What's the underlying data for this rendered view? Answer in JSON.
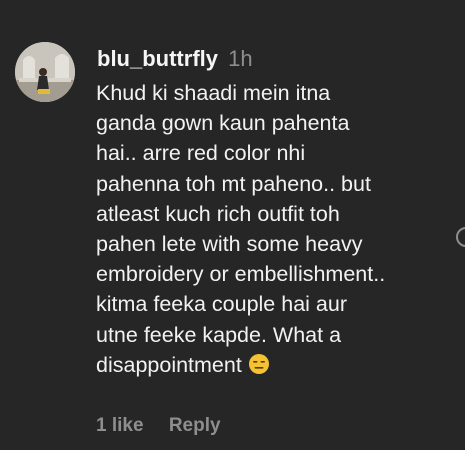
{
  "comment": {
    "username": "blu_buttrfly",
    "time": "1h",
    "lines": [
      "Khud ki shaadi mein itna",
      "ganda gown kaun pahenta",
      "hai.. arre red color nhi",
      "pahenna toh mt paheno.. but",
      "atleast kuch rich outfit toh",
      "pahen lete with some heavy",
      "embroidery or embellishment..",
      "kitma feeka couple hai aur",
      "utne feeke kapde. What a",
      "disappointment"
    ],
    "emoji": "expressionless-face-emoji",
    "likes": "1 like",
    "reply_label": "Reply"
  },
  "colors": {
    "background": "#262626",
    "text": "#f5f5f5",
    "muted": "#8e8e8e",
    "emoji": "#f5c234"
  }
}
